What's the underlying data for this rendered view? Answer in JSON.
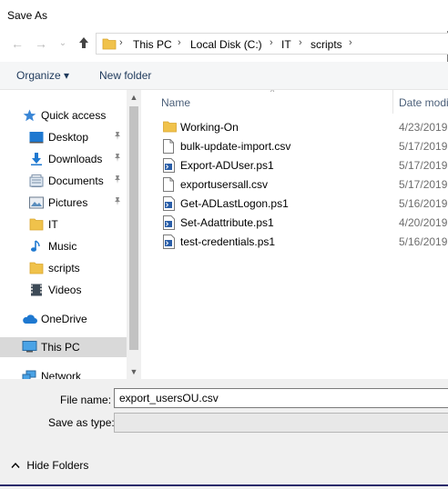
{
  "window": {
    "title": "Save As"
  },
  "nav": {
    "back": "←",
    "forward": "→",
    "recent": "⌄",
    "up": "🡑",
    "breadcrumb": [
      "This PC",
      "Local Disk (C:)",
      "IT",
      "scripts"
    ],
    "separator": "›"
  },
  "toolbar": {
    "organize": "Organize ▾",
    "new_folder": "New folder"
  },
  "sidebar": {
    "items": [
      {
        "label": "Quick access",
        "icon": "star-icon"
      },
      {
        "label": "Desktop",
        "icon": "desktop-icon",
        "pinned": true
      },
      {
        "label": "Downloads",
        "icon": "download-icon",
        "pinned": true
      },
      {
        "label": "Documents",
        "icon": "documents-icon",
        "pinned": true
      },
      {
        "label": "Pictures",
        "icon": "pictures-icon",
        "pinned": true
      },
      {
        "label": "IT",
        "icon": "folder-icon"
      },
      {
        "label": "Music",
        "icon": "music-icon"
      },
      {
        "label": "scripts",
        "icon": "folder-icon"
      },
      {
        "label": "Videos",
        "icon": "videos-icon"
      },
      {
        "label": "OneDrive",
        "icon": "cloud-icon"
      },
      {
        "label": "This PC",
        "icon": "computer-icon",
        "selected": true
      },
      {
        "label": "Network",
        "icon": "network-icon"
      }
    ],
    "pin_glyph": "📌",
    "scroll_up": "▲",
    "scroll_down": "▼"
  },
  "files": {
    "columns": {
      "name": "Name",
      "date": "Date modi",
      "sort_glyph": "^"
    },
    "rows": [
      {
        "name": "Working-On",
        "date": "4/23/2019",
        "type": "folder"
      },
      {
        "name": "bulk-update-import.csv",
        "date": "5/17/2019",
        "type": "csv"
      },
      {
        "name": "Export-ADUser.ps1",
        "date": "5/17/2019",
        "type": "ps1"
      },
      {
        "name": "exportusersall.csv",
        "date": "5/17/2019",
        "type": "csv"
      },
      {
        "name": "Get-ADLastLogon.ps1",
        "date": "5/16/2019",
        "type": "ps1"
      },
      {
        "name": "Set-Adattribute.ps1",
        "date": "4/20/2019",
        "type": "ps1"
      },
      {
        "name": "test-credentials.ps1",
        "date": "5/16/2019",
        "type": "ps1"
      }
    ]
  },
  "form": {
    "filename_label": "File name:",
    "filename_value": "export_usersOU.csv",
    "savetype_label": "Save as type:",
    "savetype_value": ""
  },
  "footer": {
    "hide_folders": "Hide Folders",
    "hide_glyph": "^"
  },
  "colors": {
    "folder": "#f0c24b",
    "selected_nav": "#d9d9d9",
    "link_blue": "#1e395b",
    "star": "#3a86d6"
  }
}
